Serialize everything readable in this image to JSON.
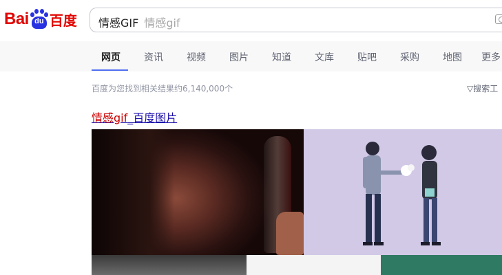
{
  "logo": {
    "bai": "Bai",
    "du": "du",
    "chinese": "百度"
  },
  "search": {
    "query": "情感GIF",
    "suggestion": "情感gif"
  },
  "nav": {
    "items": [
      "网页",
      "资讯",
      "视频",
      "图片",
      "知道",
      "文库",
      "贴吧",
      "采购",
      "地图",
      "更多"
    ],
    "active_index": 0
  },
  "results": {
    "count_text": "百度为您找到相关结果约6,140,000个",
    "tools_label": "▽搜索工",
    "first_title_highlight": "情感gif",
    "first_title_rest": "_百度图片"
  },
  "colors": {
    "brand_red": "#e10602",
    "brand_blue": "#2932e1",
    "nav_active_underline": "#4e6ef2",
    "link": "#1a0dab"
  }
}
